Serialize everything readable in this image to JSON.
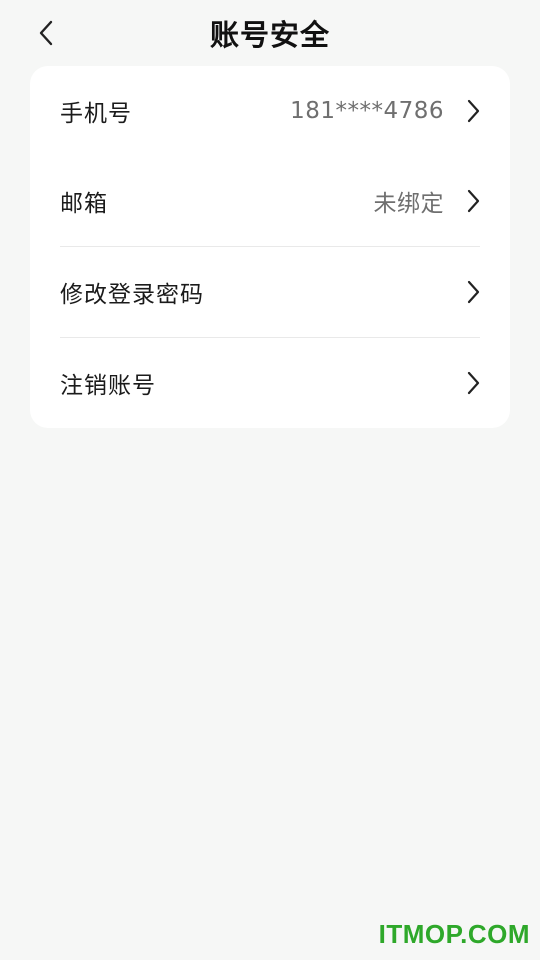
{
  "header": {
    "title": "账号安全",
    "back_icon": "chevron-left-icon"
  },
  "settings": {
    "items": [
      {
        "label": "手机号",
        "value": "181****4786",
        "icon": "chevron-right-icon"
      },
      {
        "label": "邮箱",
        "value": "未绑定",
        "icon": "chevron-right-icon"
      },
      {
        "label": "修改登录密码",
        "value": "",
        "icon": "chevron-right-icon"
      },
      {
        "label": "注销账号",
        "value": "",
        "icon": "chevron-right-icon"
      }
    ]
  },
  "watermark": "ITMOP.COM",
  "colors": {
    "background": "#f6f7f6",
    "card": "#ffffff",
    "text": "#1b1b1b",
    "secondary_text": "#6f6f6f",
    "watermark": "#2ea82a"
  }
}
